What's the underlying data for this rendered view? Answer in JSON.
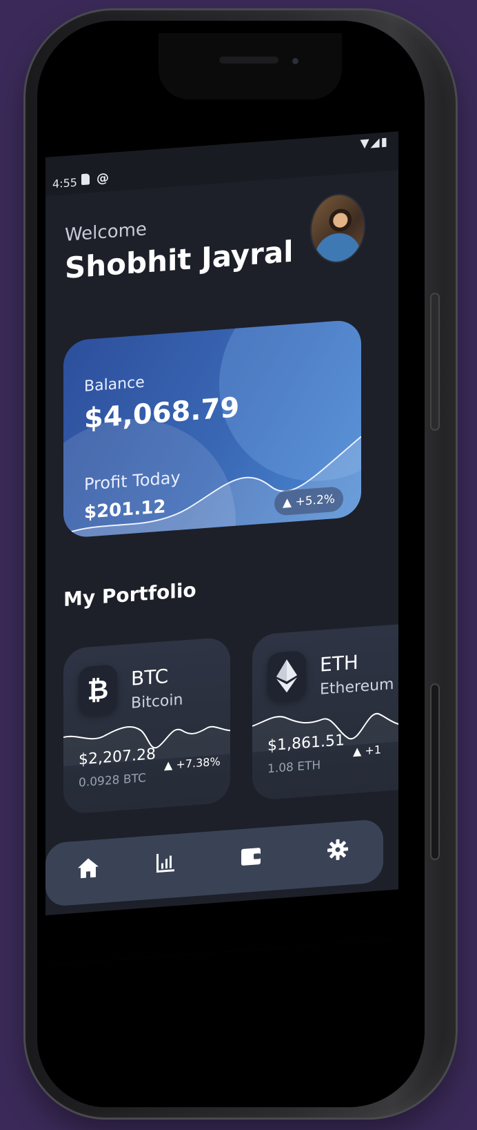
{
  "status_bar": {
    "time": "4:55"
  },
  "header": {
    "welcome": "Welcome",
    "user_name": "Shobhit Jayral"
  },
  "balance_card": {
    "balance_label": "Balance",
    "balance_value": "$4,068.79",
    "profit_label": "Profit Today",
    "profit_value": "$201.12",
    "profit_change": "+5.2%"
  },
  "portfolio": {
    "title": "My Portfolio",
    "coins": [
      {
        "symbol": "BTC",
        "name": "Bitcoin",
        "value": "$2,207.28",
        "quantity": "0.0928 BTC",
        "change": "+7.38%",
        "icon": "bitcoin-icon"
      },
      {
        "symbol": "ETH",
        "name": "Ethereum",
        "value": "$1,861.51",
        "quantity": "1.08 ETH",
        "change": "+1",
        "icon": "ethereum-icon"
      }
    ]
  },
  "navigation": {
    "items": [
      "home-icon",
      "chart-icon",
      "wallet-icon",
      "settings-icon"
    ],
    "active": "home-icon"
  },
  "colors": {
    "background": "#3b2a59",
    "screen_bg": "#1d2029",
    "card_blue": "#3a68b5",
    "nav_bg": "#3a4356"
  }
}
